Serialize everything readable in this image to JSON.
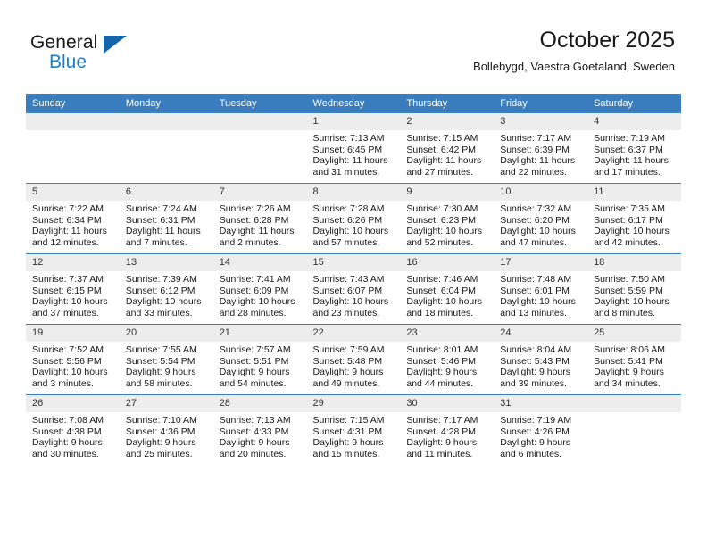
{
  "brand": {
    "name_part1": "General",
    "name_part2": "Blue",
    "accent_color": "#1b7fd4",
    "triangle_color": "#1565a8"
  },
  "header": {
    "title": "October 2025",
    "location": "Bollebygd, Vaestra Goetaland, Sweden"
  },
  "calendar": {
    "header_bg": "#3a7dbf",
    "daynum_bg": "#ededed",
    "weekday_headers": [
      "Sunday",
      "Monday",
      "Tuesday",
      "Wednesday",
      "Thursday",
      "Friday",
      "Saturday"
    ],
    "weeks": [
      [
        {
          "day": "",
          "empty": true
        },
        {
          "day": "",
          "empty": true
        },
        {
          "day": "",
          "empty": true
        },
        {
          "day": "1",
          "sunrise": "Sunrise: 7:13 AM",
          "sunset": "Sunset: 6:45 PM",
          "daylight": "Daylight: 11 hours and 31 minutes."
        },
        {
          "day": "2",
          "sunrise": "Sunrise: 7:15 AM",
          "sunset": "Sunset: 6:42 PM",
          "daylight": "Daylight: 11 hours and 27 minutes."
        },
        {
          "day": "3",
          "sunrise": "Sunrise: 7:17 AM",
          "sunset": "Sunset: 6:39 PM",
          "daylight": "Daylight: 11 hours and 22 minutes."
        },
        {
          "day": "4",
          "sunrise": "Sunrise: 7:19 AM",
          "sunset": "Sunset: 6:37 PM",
          "daylight": "Daylight: 11 hours and 17 minutes."
        }
      ],
      [
        {
          "day": "5",
          "sunrise": "Sunrise: 7:22 AM",
          "sunset": "Sunset: 6:34 PM",
          "daylight": "Daylight: 11 hours and 12 minutes."
        },
        {
          "day": "6",
          "sunrise": "Sunrise: 7:24 AM",
          "sunset": "Sunset: 6:31 PM",
          "daylight": "Daylight: 11 hours and 7 minutes."
        },
        {
          "day": "7",
          "sunrise": "Sunrise: 7:26 AM",
          "sunset": "Sunset: 6:28 PM",
          "daylight": "Daylight: 11 hours and 2 minutes."
        },
        {
          "day": "8",
          "sunrise": "Sunrise: 7:28 AM",
          "sunset": "Sunset: 6:26 PM",
          "daylight": "Daylight: 10 hours and 57 minutes."
        },
        {
          "day": "9",
          "sunrise": "Sunrise: 7:30 AM",
          "sunset": "Sunset: 6:23 PM",
          "daylight": "Daylight: 10 hours and 52 minutes."
        },
        {
          "day": "10",
          "sunrise": "Sunrise: 7:32 AM",
          "sunset": "Sunset: 6:20 PM",
          "daylight": "Daylight: 10 hours and 47 minutes."
        },
        {
          "day": "11",
          "sunrise": "Sunrise: 7:35 AM",
          "sunset": "Sunset: 6:17 PM",
          "daylight": "Daylight: 10 hours and 42 minutes."
        }
      ],
      [
        {
          "day": "12",
          "sunrise": "Sunrise: 7:37 AM",
          "sunset": "Sunset: 6:15 PM",
          "daylight": "Daylight: 10 hours and 37 minutes."
        },
        {
          "day": "13",
          "sunrise": "Sunrise: 7:39 AM",
          "sunset": "Sunset: 6:12 PM",
          "daylight": "Daylight: 10 hours and 33 minutes."
        },
        {
          "day": "14",
          "sunrise": "Sunrise: 7:41 AM",
          "sunset": "Sunset: 6:09 PM",
          "daylight": "Daylight: 10 hours and 28 minutes."
        },
        {
          "day": "15",
          "sunrise": "Sunrise: 7:43 AM",
          "sunset": "Sunset: 6:07 PM",
          "daylight": "Daylight: 10 hours and 23 minutes."
        },
        {
          "day": "16",
          "sunrise": "Sunrise: 7:46 AM",
          "sunset": "Sunset: 6:04 PM",
          "daylight": "Daylight: 10 hours and 18 minutes."
        },
        {
          "day": "17",
          "sunrise": "Sunrise: 7:48 AM",
          "sunset": "Sunset: 6:01 PM",
          "daylight": "Daylight: 10 hours and 13 minutes."
        },
        {
          "day": "18",
          "sunrise": "Sunrise: 7:50 AM",
          "sunset": "Sunset: 5:59 PM",
          "daylight": "Daylight: 10 hours and 8 minutes."
        }
      ],
      [
        {
          "day": "19",
          "sunrise": "Sunrise: 7:52 AM",
          "sunset": "Sunset: 5:56 PM",
          "daylight": "Daylight: 10 hours and 3 minutes."
        },
        {
          "day": "20",
          "sunrise": "Sunrise: 7:55 AM",
          "sunset": "Sunset: 5:54 PM",
          "daylight": "Daylight: 9 hours and 58 minutes."
        },
        {
          "day": "21",
          "sunrise": "Sunrise: 7:57 AM",
          "sunset": "Sunset: 5:51 PM",
          "daylight": "Daylight: 9 hours and 54 minutes."
        },
        {
          "day": "22",
          "sunrise": "Sunrise: 7:59 AM",
          "sunset": "Sunset: 5:48 PM",
          "daylight": "Daylight: 9 hours and 49 minutes."
        },
        {
          "day": "23",
          "sunrise": "Sunrise: 8:01 AM",
          "sunset": "Sunset: 5:46 PM",
          "daylight": "Daylight: 9 hours and 44 minutes."
        },
        {
          "day": "24",
          "sunrise": "Sunrise: 8:04 AM",
          "sunset": "Sunset: 5:43 PM",
          "daylight": "Daylight: 9 hours and 39 minutes."
        },
        {
          "day": "25",
          "sunrise": "Sunrise: 8:06 AM",
          "sunset": "Sunset: 5:41 PM",
          "daylight": "Daylight: 9 hours and 34 minutes."
        }
      ],
      [
        {
          "day": "26",
          "sunrise": "Sunrise: 7:08 AM",
          "sunset": "Sunset: 4:38 PM",
          "daylight": "Daylight: 9 hours and 30 minutes."
        },
        {
          "day": "27",
          "sunrise": "Sunrise: 7:10 AM",
          "sunset": "Sunset: 4:36 PM",
          "daylight": "Daylight: 9 hours and 25 minutes."
        },
        {
          "day": "28",
          "sunrise": "Sunrise: 7:13 AM",
          "sunset": "Sunset: 4:33 PM",
          "daylight": "Daylight: 9 hours and 20 minutes."
        },
        {
          "day": "29",
          "sunrise": "Sunrise: 7:15 AM",
          "sunset": "Sunset: 4:31 PM",
          "daylight": "Daylight: 9 hours and 15 minutes."
        },
        {
          "day": "30",
          "sunrise": "Sunrise: 7:17 AM",
          "sunset": "Sunset: 4:28 PM",
          "daylight": "Daylight: 9 hours and 11 minutes."
        },
        {
          "day": "31",
          "sunrise": "Sunrise: 7:19 AM",
          "sunset": "Sunset: 4:26 PM",
          "daylight": "Daylight: 9 hours and 6 minutes."
        },
        {
          "day": "",
          "empty": true
        }
      ]
    ]
  }
}
